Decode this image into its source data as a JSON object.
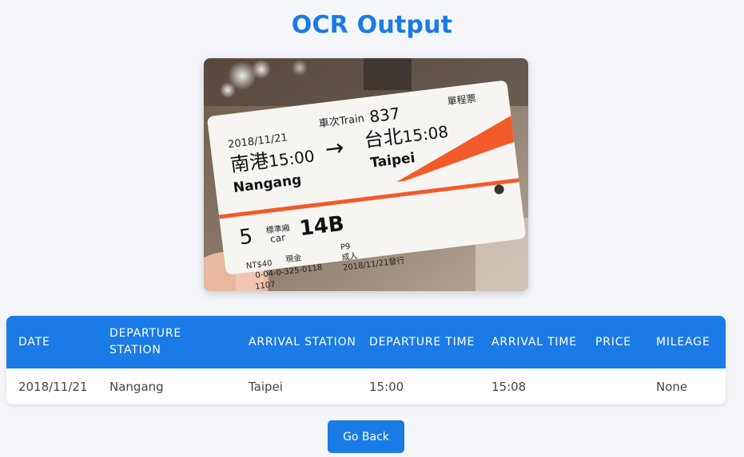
{
  "page": {
    "title": "OCR Output"
  },
  "ticket": {
    "header_right": "單程票",
    "train_label": "車次Train",
    "train_no": "837",
    "date": "2018/11/21",
    "from_cn": "南港",
    "from_time": "15:00",
    "from_en": "Nangang",
    "to_cn": "台北",
    "to_time": "15:08",
    "to_en": "Taipei",
    "car_no": "5",
    "car_label_cn": "標準廂",
    "car_label_en": "car",
    "seat": "14B",
    "fare": "NT$40",
    "payment": "現金",
    "platform": "P9",
    "passenger": "成人",
    "ticket_no": "0-04-0-325-0118",
    "issue": "2018/11/21發行",
    "code": "1107"
  },
  "table": {
    "headers": [
      "DATE",
      "DEPARTURE STATION",
      "ARRIVAL STATION",
      "DEPARTURE TIME",
      "ARRIVAL TIME",
      "PRICE",
      "MILEAGE"
    ],
    "rows": [
      [
        "2018/11/21",
        "Nangang",
        "Taipei",
        "15:00",
        "15:08",
        "",
        "None"
      ]
    ]
  },
  "actions": {
    "back_label": "Go Back"
  },
  "colors": {
    "accent": "#1a7be6",
    "background": "#f4f6f9",
    "ticket_stripe": "#f25a2a"
  }
}
